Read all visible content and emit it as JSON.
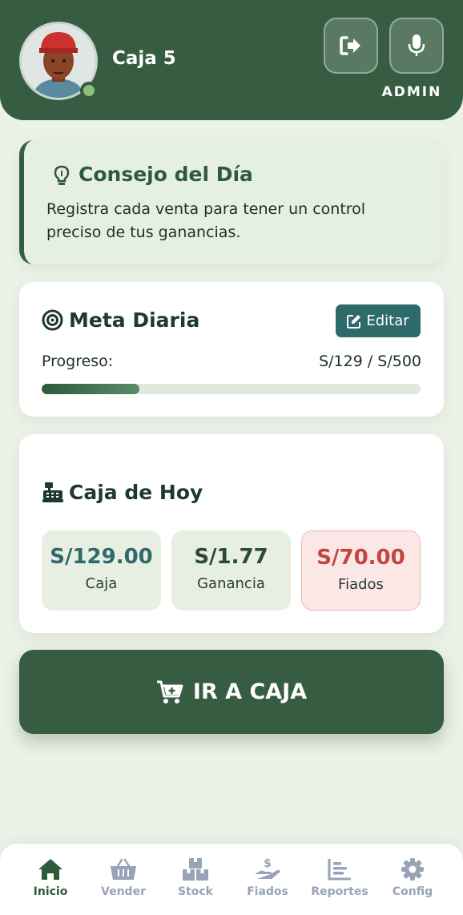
{
  "header": {
    "user_name": "Caja 5",
    "role": "ADMIN",
    "logout_icon": "logout-icon",
    "mic_icon": "microphone-icon"
  },
  "tip": {
    "title": "Consejo del Día",
    "text": "Registra cada venta para tener un control preciso de tus ganancias."
  },
  "goal": {
    "title": "Meta Diaria",
    "edit_label": "Editar",
    "progress_label": "Progreso:",
    "progress_value": "S/129 / S/500",
    "progress_fraction": 0.258
  },
  "today": {
    "title": "Caja de Hoy",
    "stats": [
      {
        "value": "S/129.00",
        "label": "Caja",
        "color": "#2f6a6b"
      },
      {
        "value": "S/1.77",
        "label": "Ganancia",
        "color": "#2b4a35"
      },
      {
        "value": "S/70.00",
        "label": "Fiados",
        "color": "#c0463f"
      }
    ]
  },
  "cta": {
    "label": "IR A CAJA"
  },
  "nav": [
    {
      "label": "Inicio",
      "icon": "home-icon"
    },
    {
      "label": "Vender",
      "icon": "basket-icon"
    },
    {
      "label": "Stock",
      "icon": "boxes-icon"
    },
    {
      "label": "Fiados",
      "icon": "hand-money-icon"
    },
    {
      "label": "Reportes",
      "icon": "chart-icon"
    },
    {
      "label": "Config",
      "icon": "gear-icon"
    }
  ],
  "colors": {
    "primary": "#365c41",
    "accent_teal": "#2f6a6b",
    "danger": "#c0463f",
    "background": "#ecf2e8"
  }
}
